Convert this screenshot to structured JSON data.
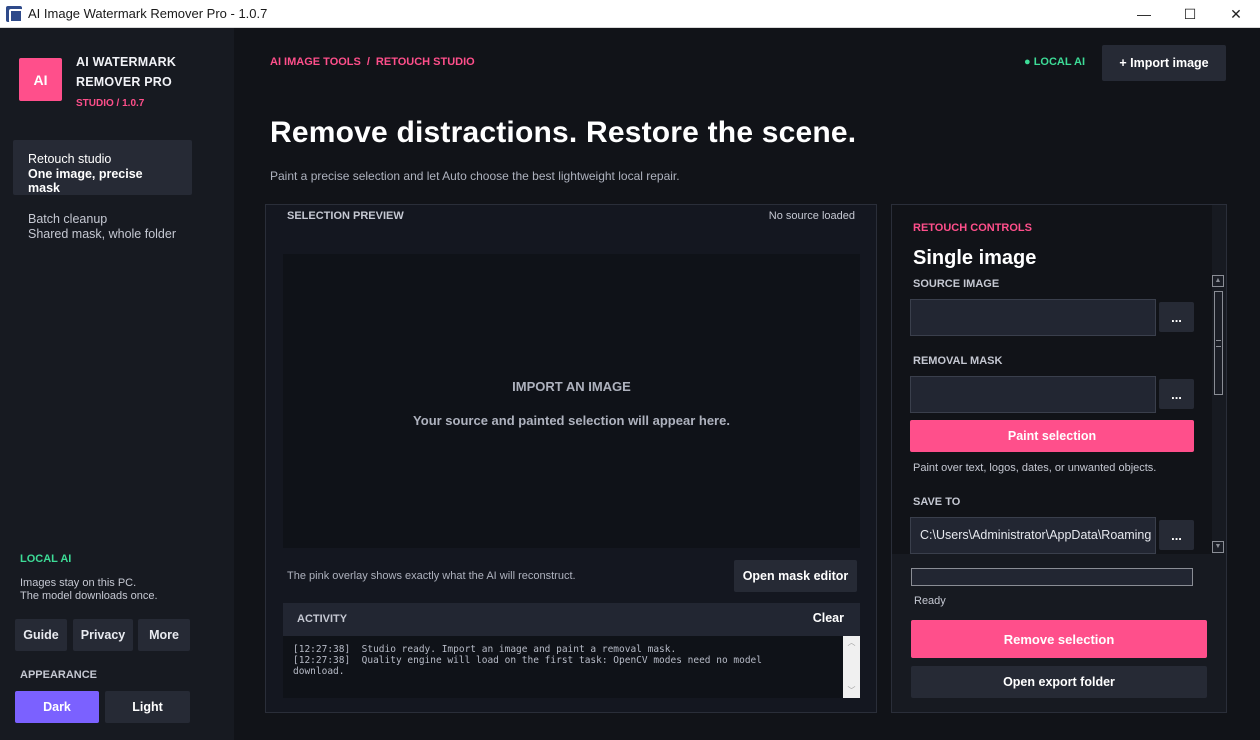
{
  "window": {
    "title": "AI Image Watermark Remover Pro - 1.0.7",
    "minimize_glyph": "—",
    "maximize_glyph": "☐",
    "close_glyph": "✕"
  },
  "sidebar": {
    "logo_text": "AI",
    "brand_name": "AI WATERMARK REMOVER PRO",
    "brand_sub": "STUDIO / 1.0.7",
    "nav": [
      {
        "line1": "Retouch studio",
        "line2": "One image, precise mask",
        "active": true
      },
      {
        "line1": "Batch cleanup",
        "line2": "Shared mask, whole folder",
        "active": false
      }
    ],
    "local_ai_title": "LOCAL AI",
    "local_ai_line1": "Images stay on this PC.",
    "local_ai_line2": "The model downloads once.",
    "buttons": {
      "guide": "Guide",
      "privacy": "Privacy",
      "more": "More"
    },
    "appearance_title": "APPEARANCE",
    "theme": {
      "dark": "Dark",
      "light": "Light",
      "selected": "Dark"
    }
  },
  "header": {
    "breadcrumb": [
      "AI IMAGE TOOLS",
      "RETOUCH STUDIO"
    ],
    "breadcrumb_sep": "/",
    "local_ai_status": "● LOCAL AI",
    "import_button": "+  Import image",
    "headline": "Remove distractions. Restore the scene.",
    "subline": "Paint a precise selection and let Auto choose the best lightweight local repair."
  },
  "preview": {
    "title": "SELECTION PREVIEW",
    "status": "No source loaded",
    "canvas_title": "IMPORT AN IMAGE",
    "canvas_message": "Your source and painted selection will appear here.",
    "overlay_note": "The pink overlay shows exactly what the AI will reconstruct.",
    "mask_editor_button": "Open mask editor",
    "activity_title": "ACTIVITY",
    "activity_clear": "Clear",
    "log": "[12:27:38]  Studio ready. Import an image and paint a removal mask.\n[12:27:38]  Quality engine will load on the first task: OpenCV modes need no model\ndownload."
  },
  "controls": {
    "kicker": "RETOUCH CONTROLS",
    "title": "Single image",
    "source_label": "SOURCE IMAGE",
    "source_value": "",
    "mask_label": "REMOVAL MASK",
    "mask_value": "",
    "browse_label": "...",
    "paint_button": "Paint selection",
    "paint_hint": "Paint over text, logos, dates, or unwanted objects.",
    "save_label": "SAVE TO",
    "save_value": "C:\\Users\\Administrator\\AppData\\Roaming",
    "progress": 0,
    "status": "Ready",
    "remove_button": "Remove selection",
    "export_button": "Open export folder"
  },
  "colors": {
    "accent": "#ff4f8b",
    "success": "#3ddc97",
    "theme_selected": "#7b61ff"
  }
}
